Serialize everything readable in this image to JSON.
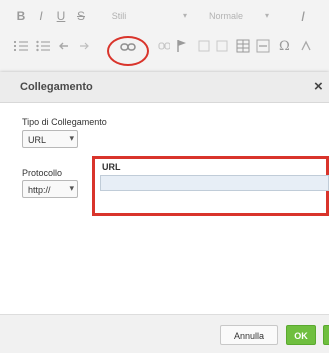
{
  "toolbar": {
    "row1": {
      "bold": "B",
      "italic": "I",
      "underline": "U",
      "strike": "S",
      "style_select": "Stili",
      "format_select": "Normale",
      "caret": "▾",
      "text_color": "I"
    }
  },
  "dialog": {
    "title": "Collegamento",
    "close": "×",
    "link_type": {
      "label": "Tipo di Collegamento",
      "value": "URL",
      "arrow": "▾"
    },
    "protocol": {
      "label": "Protocollo",
      "value": "http://",
      "arrow": "▾"
    },
    "url": {
      "label": "URL",
      "value": ""
    },
    "buttons": {
      "cancel": "Annulla",
      "ok": "OK"
    }
  },
  "colors": {
    "highlight": "#d9342b",
    "ok_button": "#6fbf3f"
  }
}
